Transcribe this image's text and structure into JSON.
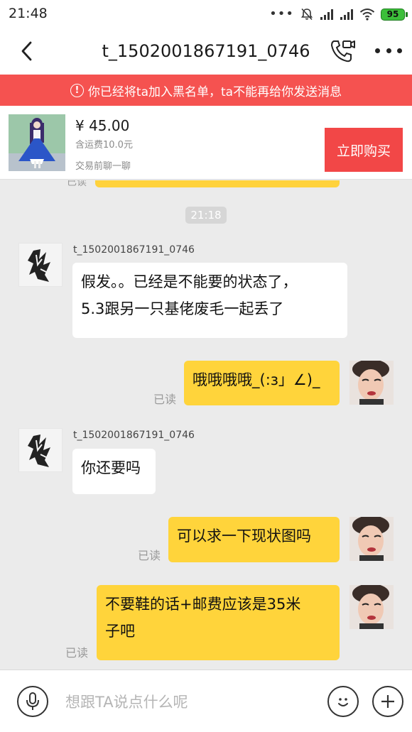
{
  "status_bar": {
    "time": "21:48",
    "dots": "•••",
    "battery": "95"
  },
  "nav": {
    "title": "t_1502001867191_0746"
  },
  "banner": {
    "warn_glyph": "!",
    "text": "你已经将ta加入黑名单，ta不能再给你发送消息"
  },
  "product": {
    "price": "¥ 45.00",
    "shipping": "含运费10.0元",
    "chat_first": "交易前聊一聊",
    "buy_label": "立即购买"
  },
  "chat": {
    "partial_read": "已读",
    "timestamp": "21:18",
    "messages": [
      {
        "side": "in",
        "sender": "t_1502001867191_0746",
        "lines": [
          "假发。。已经是不能要的状态了，",
          "5.3跟另一只基佬废毛一起丢了"
        ]
      },
      {
        "side": "out",
        "read": "已读",
        "lines": [
          "哦哦哦哦_(:з」∠)_"
        ]
      },
      {
        "side": "in",
        "sender": "t_1502001867191_0746",
        "lines": [
          "你还要吗"
        ]
      },
      {
        "side": "out",
        "read": "已读",
        "lines": [
          "可以求一下现状图吗"
        ]
      },
      {
        "side": "out",
        "read": "已读",
        "lines": [
          "不要鞋的话+邮费应该是35米",
          "子吧"
        ]
      }
    ]
  },
  "input": {
    "placeholder": "想跟TA说点什么呢"
  },
  "icons": {
    "back": "chevron-left-icon",
    "video": "video-call-icon",
    "more": "more-icon",
    "mic": "microphone-icon",
    "emoji": "emoji-icon",
    "plus": "plus-icon"
  },
  "colors": {
    "banner": "#f55250",
    "buy_button": "#f24747",
    "outgoing_bubble": "#ffd43b",
    "incoming_bubble": "#ffffff",
    "chat_background": "#ebebeb"
  }
}
